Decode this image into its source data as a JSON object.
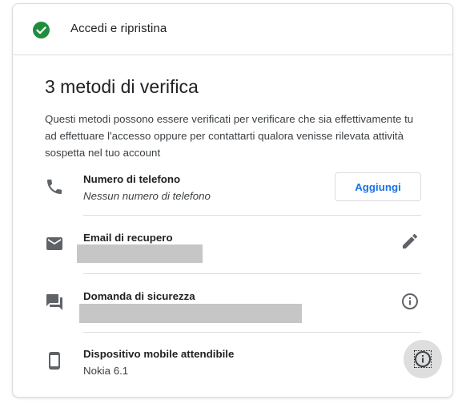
{
  "header": {
    "title": "Accedi e ripristina",
    "status_icon": "check-circle-icon",
    "status_color": "#1e8e3e"
  },
  "section": {
    "title": "3 metodi di verifica",
    "description": "Questi metodi possono essere verificati per verificare che sia effettivamente tu ad effettuare l'accesso oppure per contattarti qualora venisse rilevata attività sospetta nel tuo account"
  },
  "methods": [
    {
      "title": "Numero di telefono",
      "subtitle": "Nessun numero di telefono",
      "icon": "phone-icon",
      "action_label": "Aggiungi"
    },
    {
      "title": "Email di recupero",
      "icon": "email-icon",
      "action_icon": "edit-pencil-icon"
    },
    {
      "title": "Domanda di sicurezza",
      "icon": "chat-bubble-icon",
      "action_icon": "info-icon"
    },
    {
      "title": "Dispositivo mobile attendibile",
      "subtitle": "Nokia 6.1",
      "icon": "smartphone-icon",
      "action_icon": "info-icon"
    }
  ],
  "colors": {
    "accent": "#1a73e8",
    "success": "#1e8e3e",
    "icon": "#5f6368",
    "divider": "#dadce0"
  }
}
